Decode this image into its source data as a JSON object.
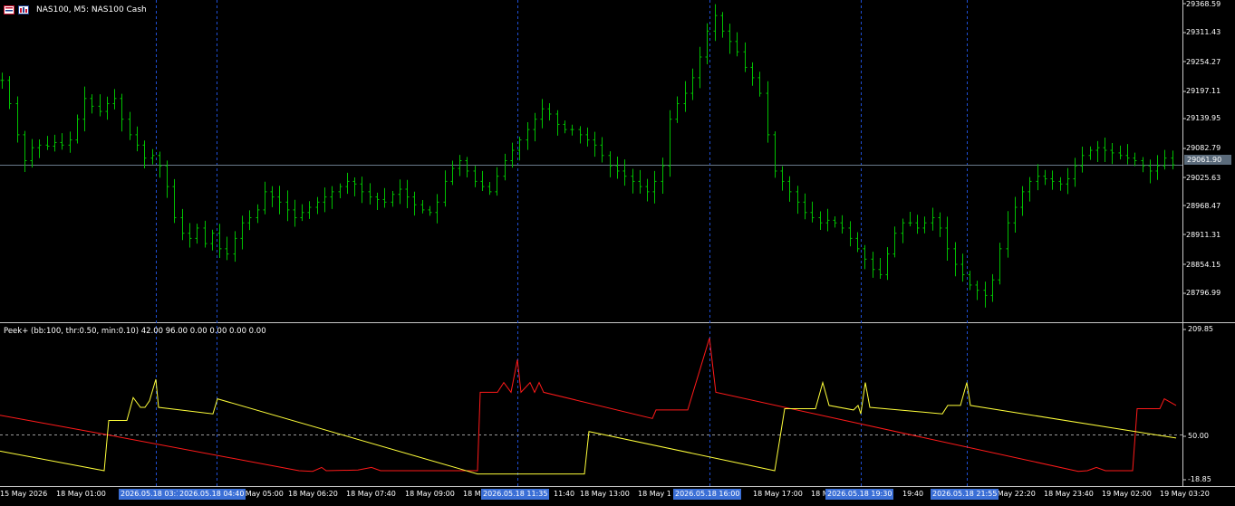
{
  "header": {
    "symbol_title": "NAS100, M5:  NAS100 Cash",
    "icons": [
      "chart-window-icon",
      "bar-chart-icon"
    ]
  },
  "price_axis": {
    "labels": [
      "29368.59",
      "29311.43",
      "29254.27",
      "29197.11",
      "29139.95",
      "29082.79",
      "29025.63",
      "28968.47",
      "28911.31",
      "28854.15",
      "28796.99"
    ],
    "current_price": "29061.90"
  },
  "indicator": {
    "title": "Peek+ (bb:100, thr:0.50, min:0.10) 42.00 96.00 0.00 0.00 0.00 0.00",
    "axis_labels": [
      "209.85",
      "50.00",
      "-18.85"
    ]
  },
  "time_axis": {
    "labels": [
      "15 May 2026",
      "18 May 01:00",
      "18 May 05:00",
      "18 May 06:20",
      "18 May 07:40",
      "18 May 09:00",
      "18 M",
      "11:40",
      "18 May 13:00",
      "18 May 1",
      "18 May 17:00",
      "18 M",
      "19:40",
      "18 May 22:20",
      "18 May 23:40",
      "19 May 02:00",
      "19 May 03:20"
    ],
    "highlights": [
      "2026.05.18 03:15",
      "2026.05.18 04:40",
      "2026.05.18 11:35",
      "2026.05.18 16:00",
      "2026.05.18 19:30",
      "2026.05.18 21:55"
    ]
  },
  "colors": {
    "background": "#000000",
    "candles": "#00c000",
    "separator_lines": "#1f4fd6",
    "indicator_red": "#ff1a1a",
    "indicator_yellow": "#ffff3a",
    "current_price_bg": "#5b6b7b"
  },
  "chart_data": [
    {
      "type": "ohlc",
      "title": "NAS100, M5:  NAS100 Cash",
      "ylim": [
        28760,
        29380
      ],
      "close_series": [
        29225,
        29180,
        29120,
        29070,
        29095,
        29100,
        29098,
        29105,
        29100,
        29110,
        29150,
        29190,
        29175,
        29165,
        29180,
        29190,
        29150,
        29120,
        29100,
        29075,
        29080,
        29060,
        29020,
        28960,
        28930,
        28920,
        28940,
        28910,
        28930,
        28900,
        28890,
        28920,
        28950,
        28960,
        28975,
        29010,
        29000,
        28990,
        28975,
        28960,
        28970,
        28980,
        28990,
        29000,
        29010,
        29020,
        29030,
        29025,
        29010,
        29000,
        28995,
        28990,
        29005,
        29015,
        29000,
        28985,
        28975,
        28970,
        28990,
        29030,
        29055,
        29070,
        29050,
        29030,
        29020,
        29010,
        29040,
        29070,
        29090,
        29110,
        29130,
        29150,
        29170,
        29160,
        29140,
        29130,
        29130,
        29120,
        29110,
        29100,
        29080,
        29060,
        29050,
        29040,
        29030,
        29020,
        29010,
        29030,
        29060,
        29150,
        29180,
        29200,
        29230,
        29270,
        29320,
        29350,
        29320,
        29300,
        29280,
        29250,
        29230,
        29200,
        29120,
        29050,
        29030,
        29010,
        28990,
        28970,
        28960,
        28950,
        28955,
        28950,
        28940,
        28920,
        28900,
        28880,
        28860,
        28850,
        28890,
        28930,
        28950,
        28950,
        28940,
        28950,
        28960,
        28940,
        28900,
        28870,
        28850,
        28830,
        28820,
        28810,
        28840,
        28900,
        28950,
        28980,
        29010,
        29030,
        29040,
        29035,
        29030,
        29025,
        29035,
        29060,
        29080,
        29090,
        29095,
        29090,
        29085,
        29080,
        29075,
        29070,
        29060,
        29050,
        29060,
        29075,
        29062
      ],
      "current_price": 29061.9
    },
    {
      "type": "line",
      "title": "Peek+ (bb:100, thr:0.50, min:0.10) 42.00 96.00 0.00 0.00 0.00 0.00",
      "ylim": [
        -18.85,
        209.85
      ],
      "level": 50.0,
      "series": [
        {
          "color": "#ff1a1a",
          "points": [
            [
              0,
              80
            ],
            [
              118,
              50
            ],
            [
              330,
              -5
            ],
            [
              345,
              -6
            ],
            [
              355,
              0
            ],
            [
              360,
              -5
            ],
            [
              395,
              -4
            ],
            [
              410,
              0
            ],
            [
              420,
              -5
            ],
            [
              527,
              -5
            ],
            [
              530,
              115
            ],
            [
              549,
              115
            ],
            [
              556,
              130
            ],
            [
              564,
              115
            ],
            [
              571,
              165
            ],
            [
              575,
              115
            ],
            [
              585,
              130
            ],
            [
              590,
              115
            ],
            [
              595,
              130
            ],
            [
              600,
              115
            ],
            [
              720,
              75
            ],
            [
              724,
              88
            ],
            [
              759,
              88
            ],
            [
              783,
              198
            ],
            [
              790,
              115
            ],
            [
              1190,
              -6
            ],
            [
              1200,
              -5
            ],
            [
              1210,
              0
            ],
            [
              1220,
              -5
            ],
            [
              1250,
              -5
            ],
            [
              1255,
              90
            ],
            [
              1280,
              90
            ],
            [
              1285,
              105
            ],
            [
              1298,
              95
            ]
          ]
        },
        {
          "color": "#ffff3a",
          "points": [
            [
              0,
              25
            ],
            [
              115,
              -5
            ],
            [
              120,
              72
            ],
            [
              140,
              72
            ],
            [
              147,
              107
            ],
            [
              155,
              92
            ],
            [
              160,
              92
            ],
            [
              165,
              102
            ],
            [
              172,
              135
            ],
            [
              175,
              92
            ],
            [
              235,
              82
            ],
            [
              240,
              105
            ],
            [
              527,
              -10
            ],
            [
              530,
              -10
            ],
            [
              645,
              -10
            ],
            [
              650,
              55
            ],
            [
              855,
              -5
            ],
            [
              860,
              38
            ],
            [
              866,
              90
            ],
            [
              900,
              90
            ],
            [
              908,
              130
            ],
            [
              915,
              95
            ],
            [
              942,
              88
            ],
            [
              947,
              95
            ],
            [
              950,
              82
            ],
            [
              955,
              130
            ],
            [
              960,
              92
            ],
            [
              1040,
              82
            ],
            [
              1046,
              95
            ],
            [
              1060,
              95
            ],
            [
              1067,
              130
            ],
            [
              1071,
              95
            ],
            [
              1298,
              45
            ]
          ]
        }
      ]
    }
  ]
}
